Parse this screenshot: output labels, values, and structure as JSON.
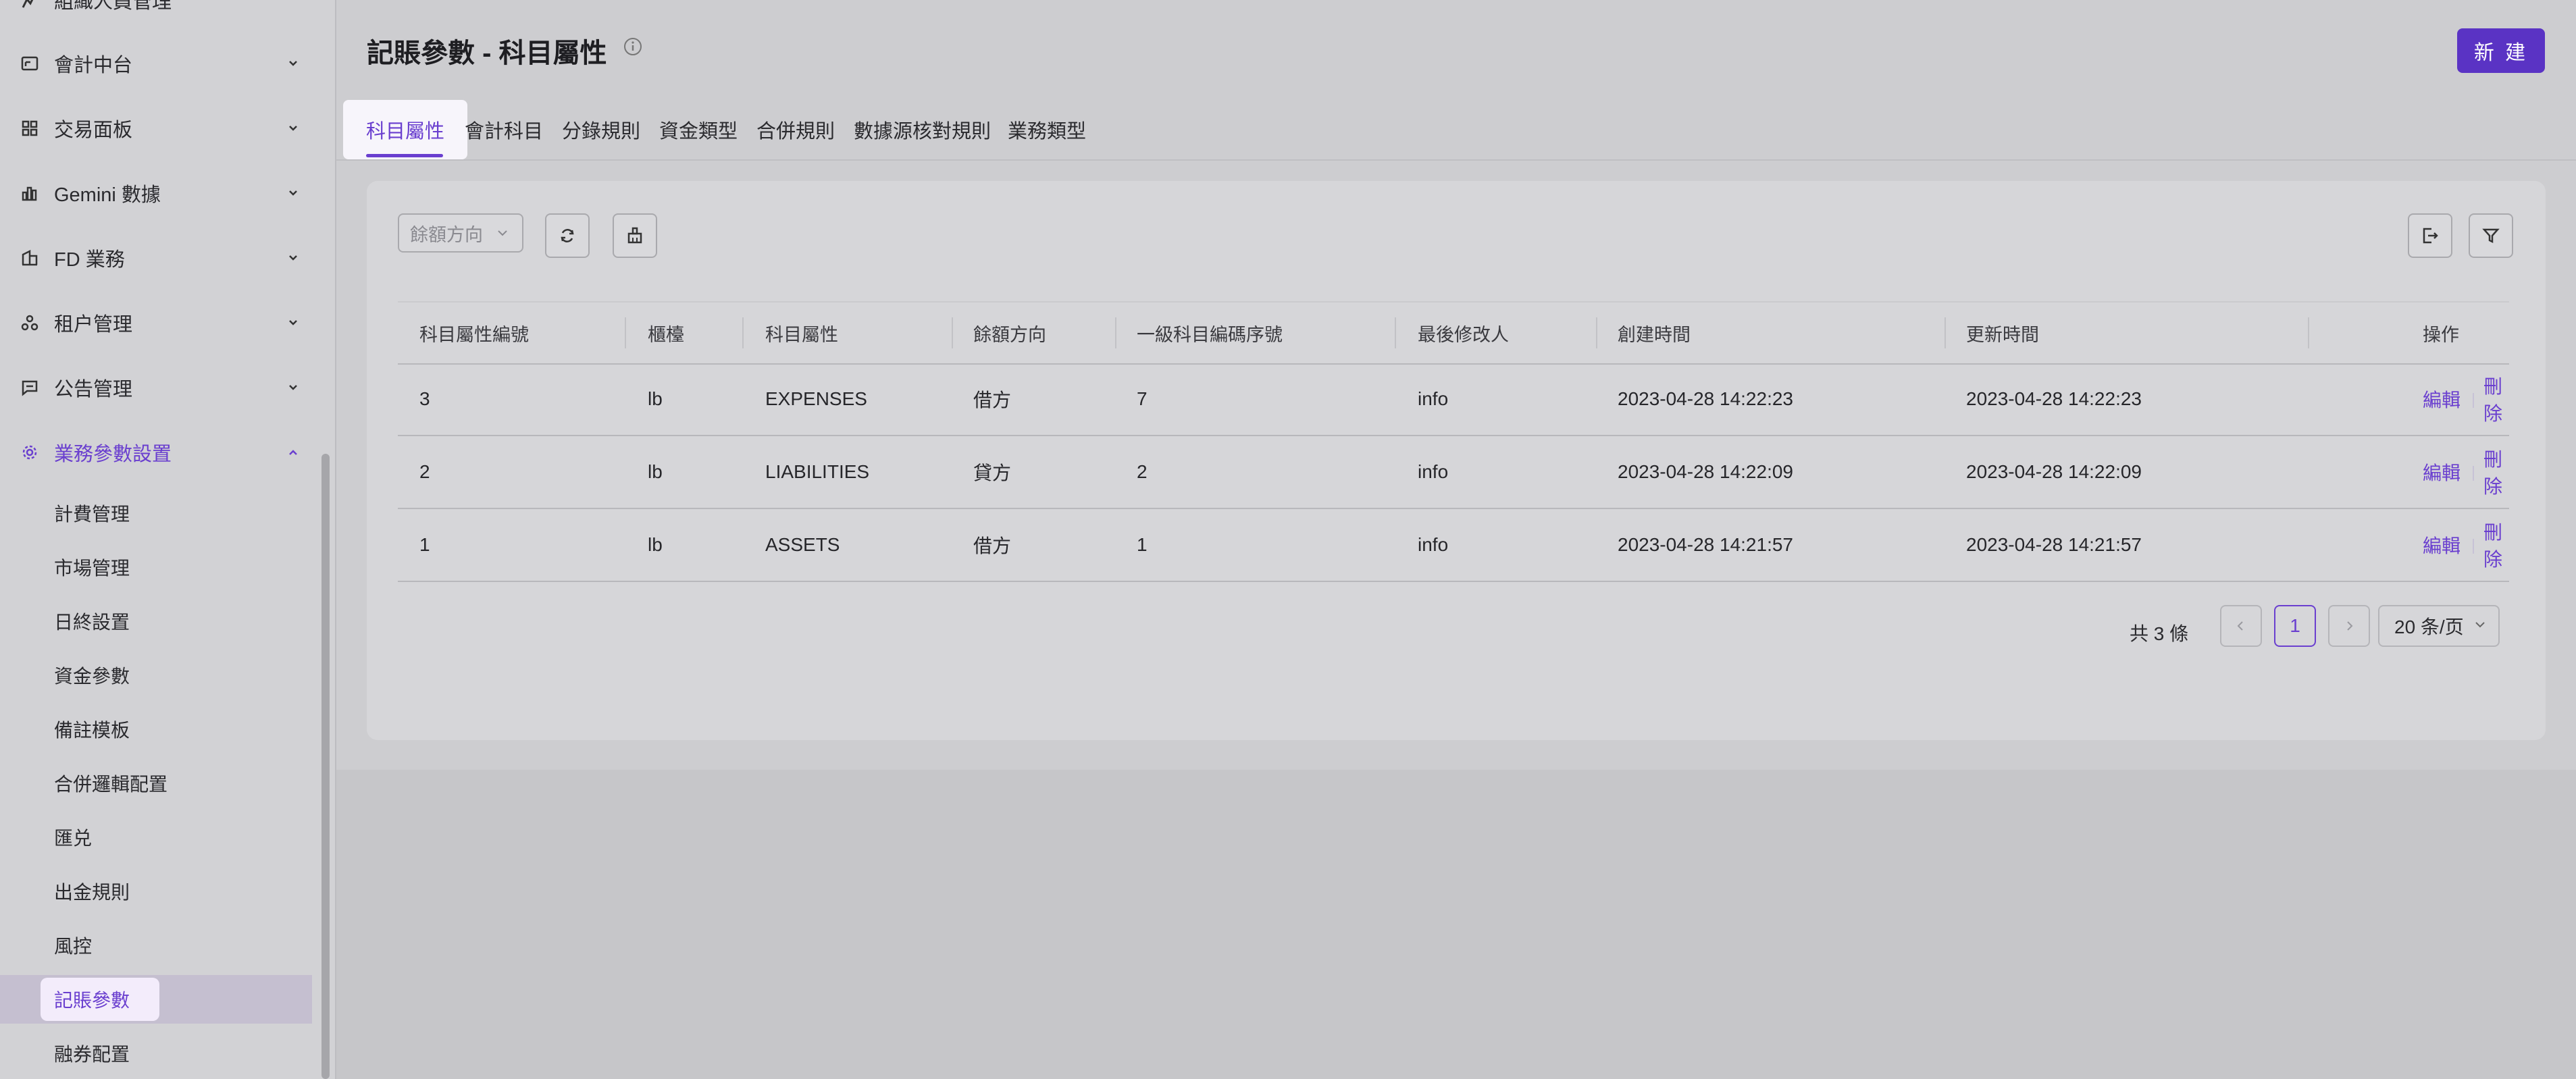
{
  "sidebar": {
    "top_partial": "組織人員管理",
    "items": [
      {
        "label": "會計中台",
        "icon": "ledger-icon"
      },
      {
        "label": "交易面板",
        "icon": "dashboard-grid-icon"
      },
      {
        "label": "Gemini 數據",
        "icon": "bar-chart-icon"
      },
      {
        "label": "FD 業務",
        "icon": "building-icon"
      },
      {
        "label": "租户管理",
        "icon": "tenant-tree-icon"
      },
      {
        "label": "公告管理",
        "icon": "message-icon"
      },
      {
        "label": "業務參數設置",
        "icon": "gear-icon"
      }
    ],
    "sub_items": [
      "計費管理",
      "市場管理",
      "日終設置",
      "資金參數",
      "備註模板",
      "合併邏輯配置",
      "匯兑",
      "出金規則",
      "風控",
      "記賬參數",
      "融券配置"
    ],
    "selected_sub": "記賬參數"
  },
  "header": {
    "title": "記賬參數 - 科目屬性",
    "new_button": "新 建"
  },
  "tabs": [
    "科目屬性",
    "會計科目",
    "分錄規則",
    "資金類型",
    "合併規則",
    "數據源核對規則",
    "業務類型"
  ],
  "filter": {
    "placeholder": "餘額方向"
  },
  "table": {
    "columns": [
      "科目屬性編號",
      "櫃檯",
      "科目屬性",
      "餘額方向",
      "一級科目編碼序號",
      "最後修改人",
      "創建時間",
      "更新時間",
      "操作"
    ],
    "rows": [
      {
        "id": "3",
        "counter": "lb",
        "attr": "EXPENSES",
        "direction": "借方",
        "seq": "7",
        "modifier": "info",
        "created": "2023-04-28 14:22:23",
        "updated": "2023-04-28 14:22:23"
      },
      {
        "id": "2",
        "counter": "lb",
        "attr": "LIABILITIES",
        "direction": "貸方",
        "seq": "2",
        "modifier": "info",
        "created": "2023-04-28 14:22:09",
        "updated": "2023-04-28 14:22:09"
      },
      {
        "id": "1",
        "counter": "lb",
        "attr": "ASSETS",
        "direction": "借方",
        "seq": "1",
        "modifier": "info",
        "created": "2023-04-28 14:21:57",
        "updated": "2023-04-28 14:21:57"
      }
    ],
    "edit_label": "編輯",
    "delete_label": "刪除"
  },
  "pagination": {
    "total": "共 3 條",
    "current_page": "1",
    "page_size": "20 条/页"
  },
  "colors": {
    "accent": "#6a3fcf",
    "primary_button": "#5a33c4"
  }
}
